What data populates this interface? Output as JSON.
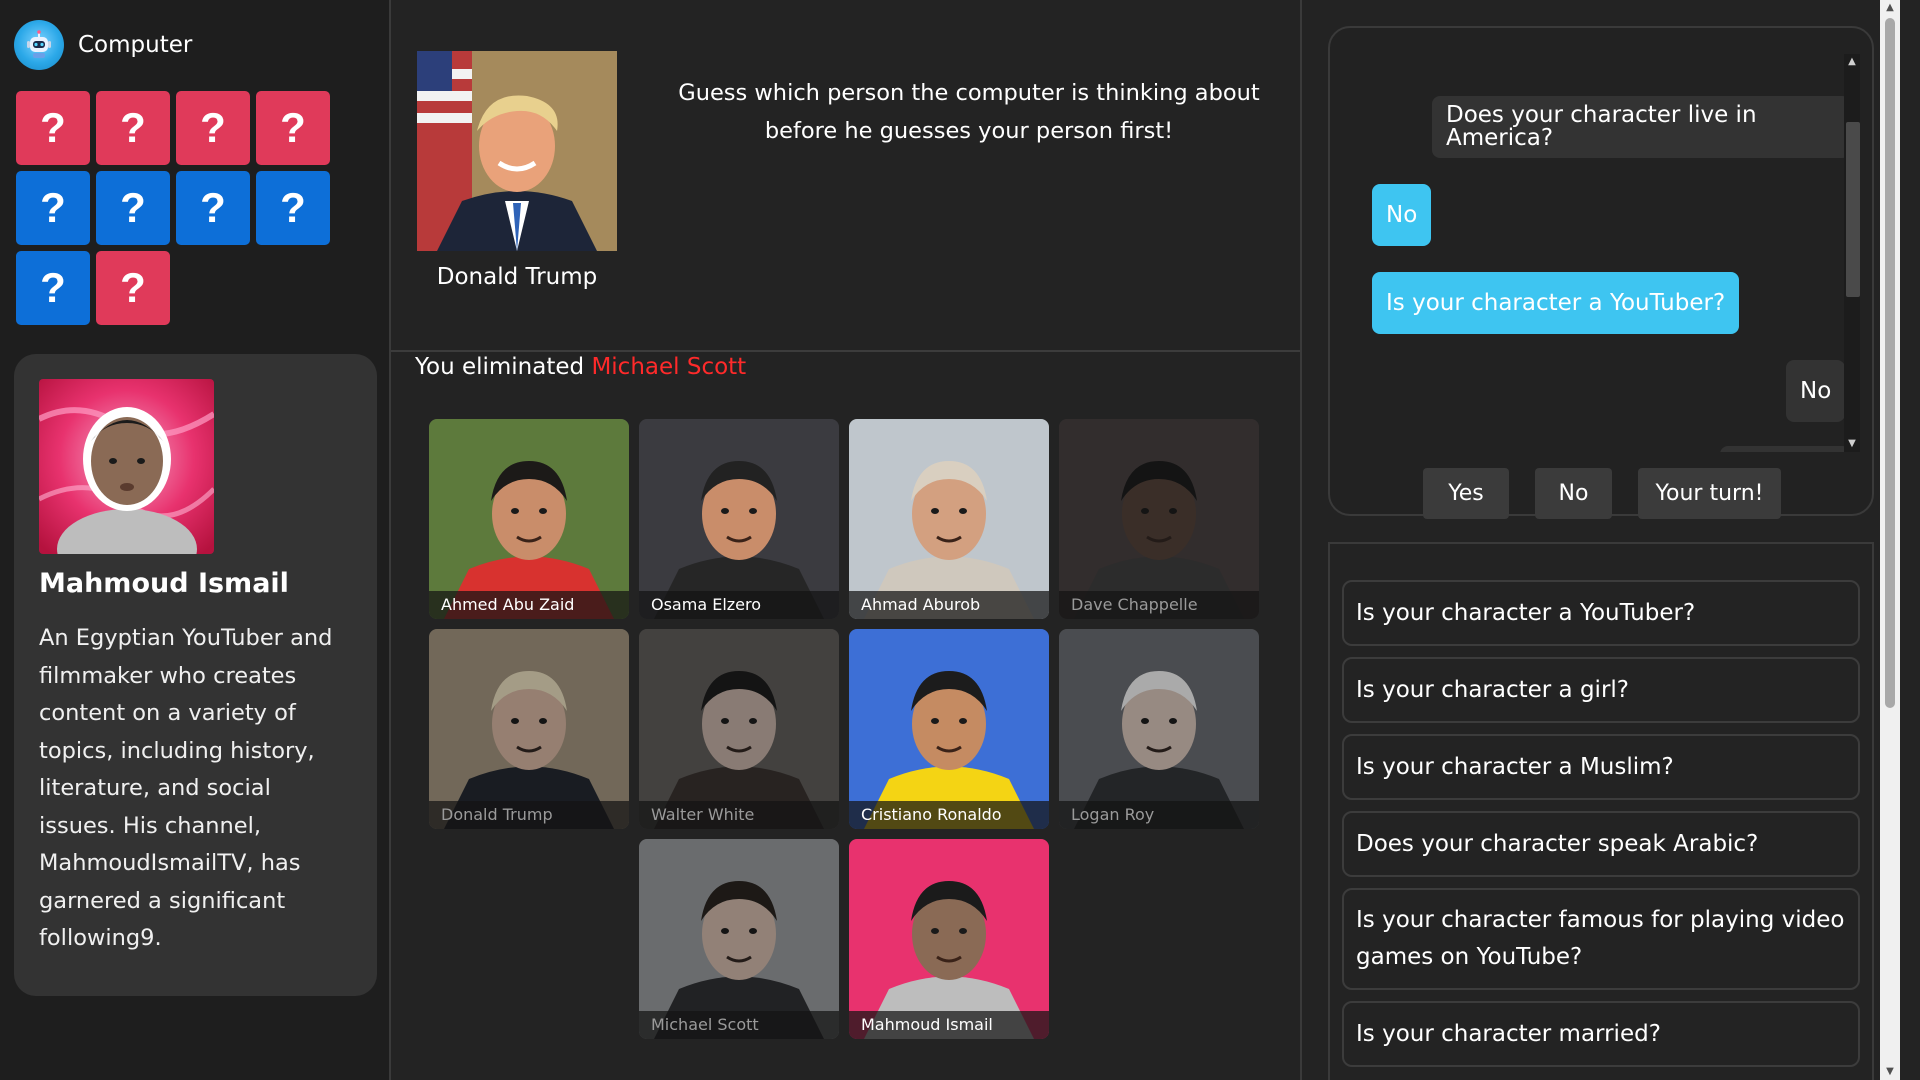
{
  "computer": {
    "title": "Computer",
    "avatar_icon": "robot-icon",
    "cards": [
      {
        "label": "?",
        "color": "red"
      },
      {
        "label": "?",
        "color": "red"
      },
      {
        "label": "?",
        "color": "red"
      },
      {
        "label": "?",
        "color": "red"
      },
      {
        "label": "?",
        "color": "blue"
      },
      {
        "label": "?",
        "color": "blue"
      },
      {
        "label": "?",
        "color": "blue"
      },
      {
        "label": "?",
        "color": "blue"
      },
      {
        "label": "?",
        "color": "blue"
      },
      {
        "label": "?",
        "color": "red"
      }
    ]
  },
  "player_character": {
    "name": "Mahmoud Ismail",
    "description": "An Egyptian YouTuber and filmmaker who creates content on a variety of topics, including history, literature, and social issues. His channel, MahmoudIsmailTV, has garnered a significant following9."
  },
  "target": {
    "name": "Donald Trump",
    "instructions": "Guess which person the computer is thinking about before he guesses your person first!"
  },
  "elimination": {
    "prefix": "You eliminated",
    "name": "Michael Scott"
  },
  "people": [
    {
      "name": "Ahmed Abu Zaid",
      "eliminated": false
    },
    {
      "name": "Osama Elzero",
      "eliminated": false
    },
    {
      "name": "Ahmad Aburob",
      "eliminated": false
    },
    {
      "name": "Dave Chappelle",
      "eliminated": true
    },
    {
      "name": "Donald Trump",
      "eliminated": true
    },
    {
      "name": "Walter White",
      "eliminated": true
    },
    {
      "name": "Cristiano Ronaldo",
      "eliminated": false
    },
    {
      "name": "Logan Roy",
      "eliminated": true
    },
    {
      "name": "Michael Scott",
      "eliminated": true
    },
    {
      "name": "Mahmoud Ismail",
      "eliminated": false
    }
  ],
  "chat": {
    "messages": [
      {
        "text": "Does your character live in America?",
        "style": "dark"
      },
      {
        "text": "No",
        "style": "blue"
      },
      {
        "text": "Is your character a YouTuber?",
        "style": "blue"
      },
      {
        "text": "No",
        "style": "dark"
      }
    ],
    "buttons": {
      "yes": "Yes",
      "no": "No",
      "your_turn": "Your turn!"
    }
  },
  "questions": [
    "Is your character a YouTuber?",
    "Is your character a girl?",
    "Is your character a Muslim?",
    "Does your character speak Arabic?",
    "Is your character famous for playing video games on YouTube?",
    "Is your character married?"
  ],
  "colors": {
    "card_red": "#e03a5a",
    "card_blue": "#0d6fd8",
    "accent_blue": "#3ec5f1",
    "eliminated_red": "#ff2a2a",
    "background": "#232323"
  }
}
